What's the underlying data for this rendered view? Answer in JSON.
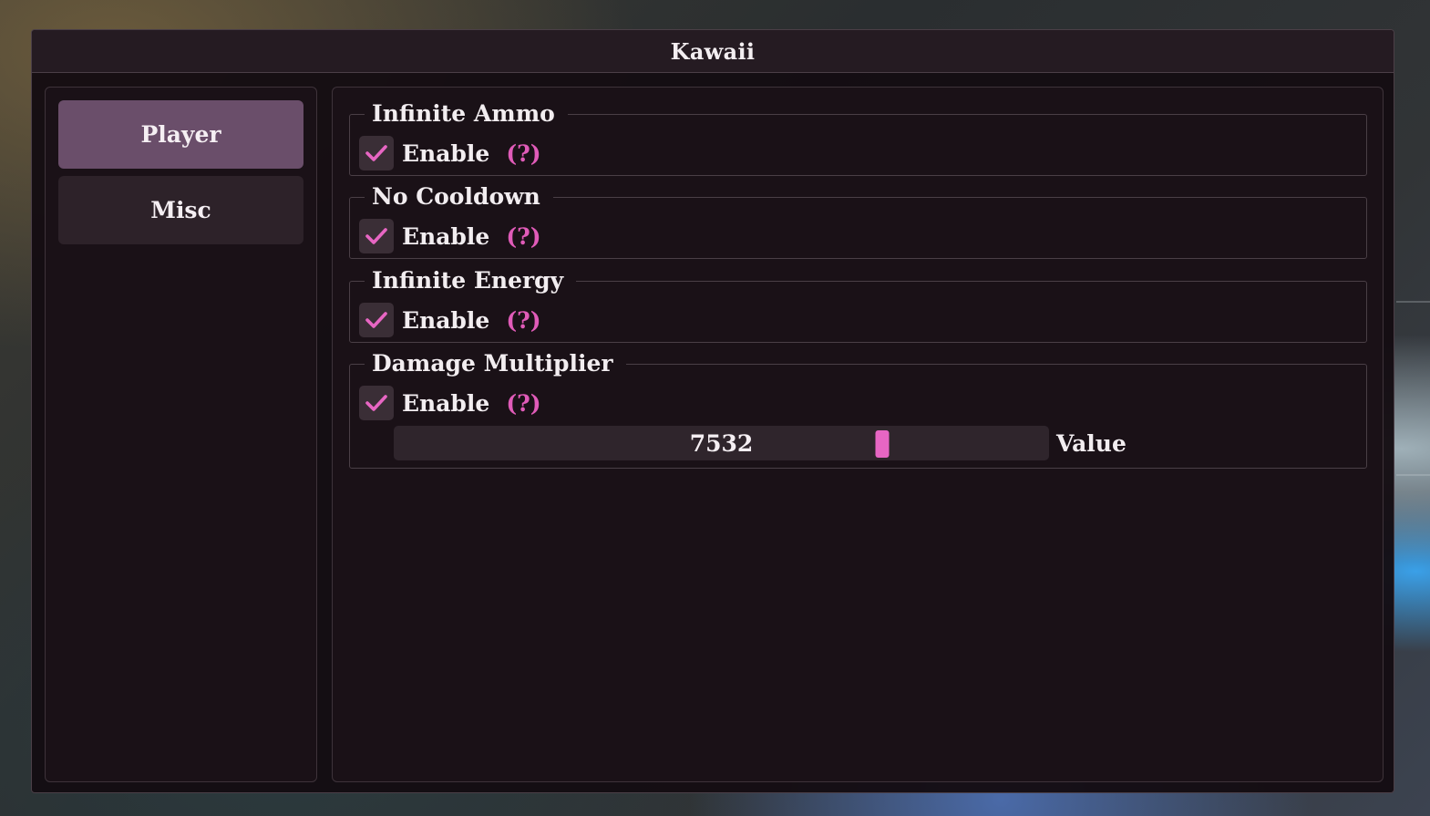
{
  "window": {
    "title": "Kawaii"
  },
  "sidebar": {
    "items": [
      {
        "label": "Player",
        "active": true
      },
      {
        "label": "Misc",
        "active": false
      }
    ]
  },
  "groups": [
    {
      "title": "Infinite Ammo",
      "checkbox_label": "Enable",
      "checked": true,
      "help": "(?)"
    },
    {
      "title": "No Cooldown",
      "checkbox_label": "Enable",
      "checked": true,
      "help": "(?)"
    },
    {
      "title": "Infinite Energy",
      "checkbox_label": "Enable",
      "checked": true,
      "help": "(?)"
    },
    {
      "title": "Damage Multiplier",
      "checkbox_label": "Enable",
      "checked": true,
      "help": "(?)"
    }
  ],
  "damage_slider": {
    "value": "7532",
    "label": "Value",
    "fraction": 0.746
  },
  "colors": {
    "accent": "#e766c3",
    "help": "#e05bb8",
    "active_tab": "#6a4e6a",
    "inactive_tab": "#2d2229",
    "panel": "#1a1117"
  },
  "icons": {
    "checkbox_mark": "check-icon"
  }
}
